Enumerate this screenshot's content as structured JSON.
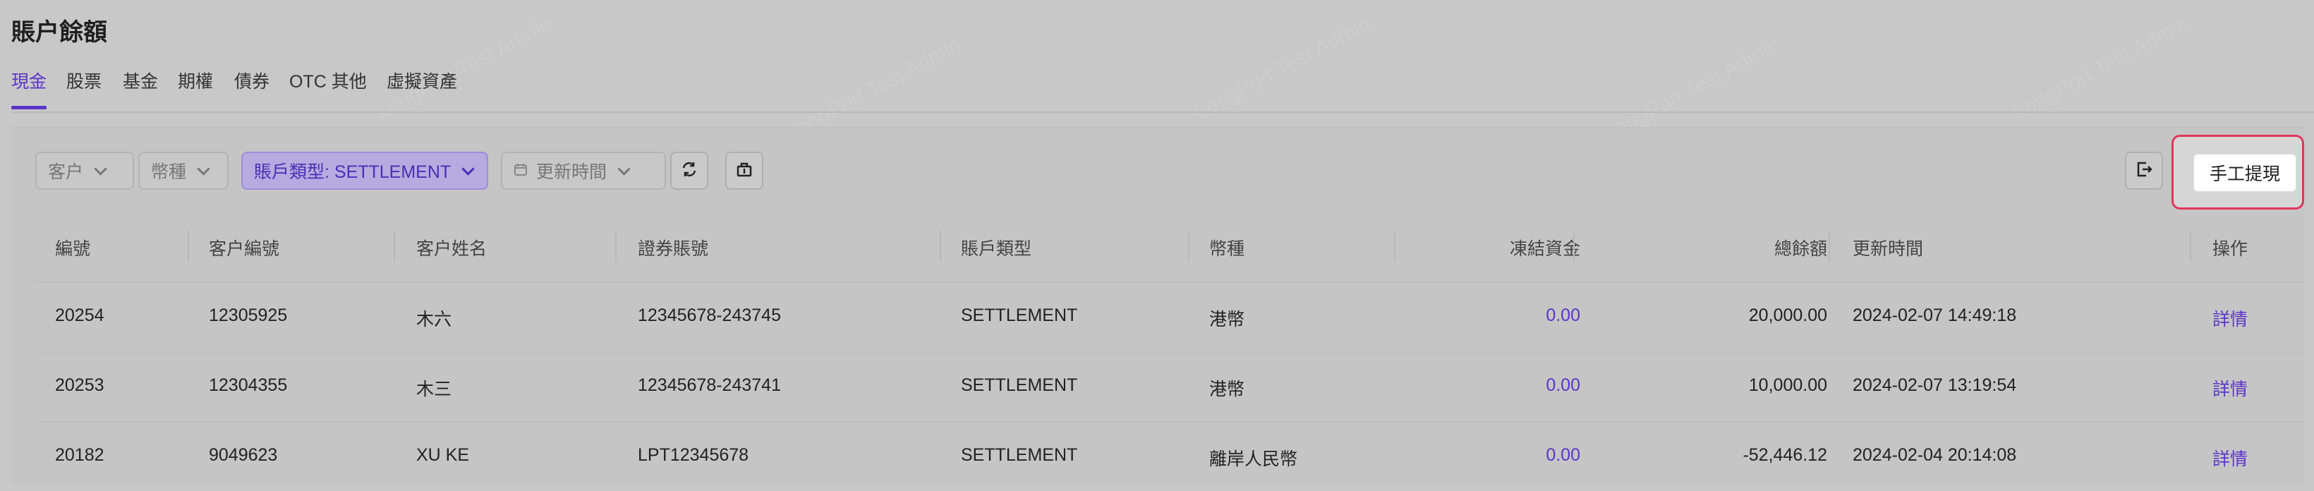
{
  "page": {
    "title": "賬户餘額"
  },
  "tabs": [
    {
      "label": "現金",
      "active": true
    },
    {
      "label": "股票"
    },
    {
      "label": "基金"
    },
    {
      "label": "期權"
    },
    {
      "label": "債券"
    },
    {
      "label": "OTC 其他"
    },
    {
      "label": "虛擬資產"
    }
  ],
  "filters": {
    "customer": "客户",
    "currency": "幣種",
    "account_type": "賬戶類型: SETTLEMENT",
    "update_time": "更新時間"
  },
  "toolbar": {
    "withdraw_label": "手工提現"
  },
  "table": {
    "columns": [
      "編號",
      "客户編號",
      "客户姓名",
      "證券賬號",
      "賬戶類型",
      "幣種",
      "凍結資金",
      "總餘額",
      "更新時間",
      "操作"
    ],
    "rows": [
      {
        "id": "20254",
        "customer_no": "12305925",
        "name": "木六",
        "account": "12345678-243745",
        "type": "SETTLEMENT",
        "currency": "港幣",
        "frozen": "0.00",
        "total": "20,000.00",
        "updated": "2024-02-07 14:49:18",
        "action": "詳情"
      },
      {
        "id": "20253",
        "customer_no": "12304355",
        "name": "木三",
        "account": "12345678-243741",
        "type": "SETTLEMENT",
        "currency": "港幣",
        "frozen": "0.00",
        "total": "10,000.00",
        "updated": "2024-02-07 13:19:54",
        "action": "詳情"
      },
      {
        "id": "20182",
        "customer_no": "9049623",
        "name": "XU KE",
        "account": "LPT12345678",
        "type": "SETTLEMENT",
        "currency": "離岸人民幣",
        "frozen": "0.00",
        "total": "-52,446.12",
        "updated": "2024-02-04 20:14:08",
        "action": "詳情"
      }
    ]
  },
  "watermark": "LongPort Test Admin",
  "colors": {
    "accent": "#5b35c9",
    "highlight_border": "#e0375a"
  }
}
